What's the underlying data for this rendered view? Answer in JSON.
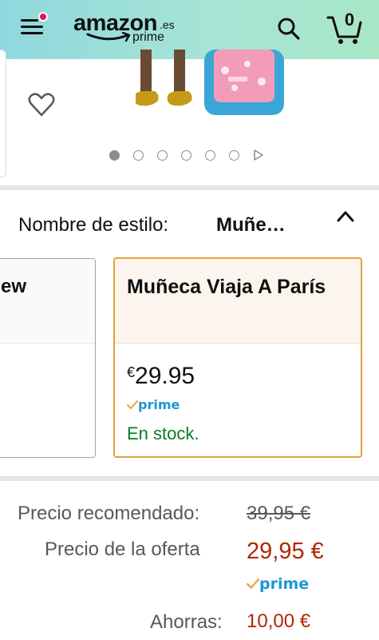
{
  "header": {
    "logo_word": "amazon",
    "logo_tld": ".es",
    "logo_prime": "prime",
    "cart_count": "0"
  },
  "gallery": {
    "dots_count": 6,
    "active_index": 0
  },
  "style_selector": {
    "label": "Nombre de estilo:",
    "value": "Muñe…"
  },
  "options": [
    {
      "title": "ew"
    },
    {
      "title": "Muñeca Viaja A París",
      "price_currency": "€",
      "price_amount": "29.95",
      "prime": "prime",
      "stock": "En stock."
    }
  ],
  "price": {
    "recommended_label": "Precio recomendado:",
    "recommended_value": "39,95 €",
    "offer_label": "Precio de la oferta",
    "offer_value": "29,95 €",
    "prime": "prime",
    "savings_label": "Ahorras:",
    "savings_value": "10,00 €"
  },
  "colors": {
    "accent_orange": "#e0a23b",
    "price_red": "#b12704",
    "stock_green": "#067d24",
    "prime_blue": "#1a98d8",
    "notification_pink": "#e3145a"
  }
}
